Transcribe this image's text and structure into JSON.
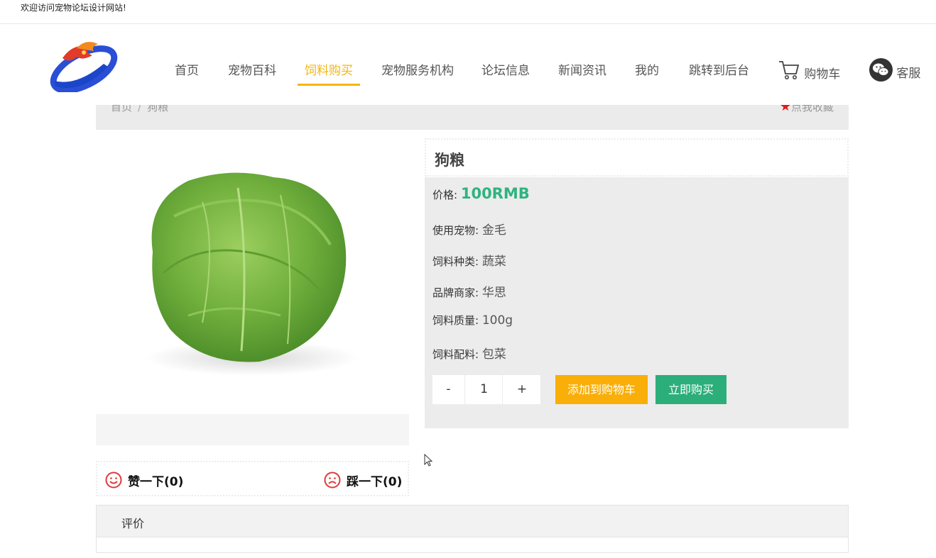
{
  "topbar": {
    "welcome": "欢迎访问宠物论坛设计网站!"
  },
  "nav": {
    "items": [
      {
        "label": "首页"
      },
      {
        "label": "宠物百科"
      },
      {
        "label": "饲料购买"
      },
      {
        "label": "宠物服务机构"
      },
      {
        "label": "论坛信息"
      },
      {
        "label": "新闻资讯"
      },
      {
        "label": "我的"
      },
      {
        "label": "跳转到后台"
      }
    ],
    "cart_label": "购物车",
    "service_label": "客服",
    "active_color": "#f5b50f"
  },
  "breadcrumb": {
    "home": "首页",
    "separator": "/",
    "current": "狗粮"
  },
  "favorite_label": "点我收藏",
  "product": {
    "title": "狗粮",
    "price_label": "价格:",
    "price": "100RMB",
    "fields": [
      {
        "label": "使用宠物:",
        "value": "金毛"
      },
      {
        "label": "饲料种类:",
        "value": "蔬菜"
      },
      {
        "label": "品牌商家:",
        "value": "华思"
      },
      {
        "label": "饲料质量:",
        "value": "100g"
      },
      {
        "label": "饲料配料:",
        "value": "包菜"
      }
    ],
    "quantity": "1",
    "minus_label": "-",
    "plus_label": "+",
    "add_to_cart_label": "添加到购物车",
    "buy_now_label": "立即购买"
  },
  "votes": {
    "like_label": "赞一下(0)",
    "dislike_label": "踩一下(0)"
  },
  "review": {
    "title": "评价"
  },
  "colors": {
    "accent": "#f5b50f",
    "price": "#2fb37f",
    "cart_button": "#f9ae08",
    "buy_button": "#2cae7a",
    "vote_icon": "#e03a3a",
    "favorite_star": "#e01c1c"
  }
}
